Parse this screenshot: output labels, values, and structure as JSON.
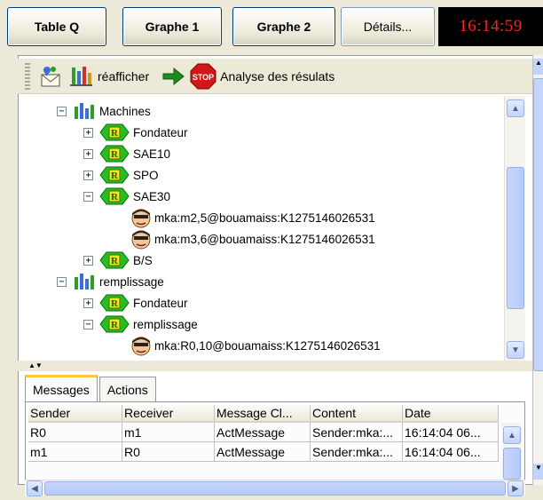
{
  "toolbar": {
    "buttons": [
      "Table Q",
      "Graphe 1",
      "Graphe 2",
      "Détails..."
    ],
    "clock": "16:14:59"
  },
  "actions": {
    "refresh_label": "réafficher",
    "analysis_label": "Analyse des résulats",
    "stop_text": "STOP"
  },
  "tree": {
    "nodes": [
      {
        "text": "Machines"
      },
      {
        "text": "Fondateur"
      },
      {
        "text": "SAE10"
      },
      {
        "text": "SPO"
      },
      {
        "text": "SAE30"
      },
      {
        "text": "mka:m2,5@bouamaiss:K1275146026531"
      },
      {
        "text": "mka:m3,6@bouamaiss:K1275146026531"
      },
      {
        "text": "B/S"
      },
      {
        "text": "remplissage"
      },
      {
        "text": "Fondateur"
      },
      {
        "text": "remplissage"
      },
      {
        "text": "mka:R0,10@bouamaiss:K1275146026531"
      }
    ],
    "badge_letter": "R"
  },
  "tabs": [
    "Messages",
    "Actions"
  ],
  "table": {
    "headers": [
      "Sender",
      "Receiver",
      "Message Cl...",
      "Content",
      "Date"
    ],
    "rows": [
      [
        "R0",
        "m1",
        "ActMessage",
        "Sender:mka:...",
        "16:14:04 06..."
      ],
      [
        "m1",
        "R0",
        "ActMessage",
        "Sender:mka:...",
        "16:14:04 06..."
      ]
    ]
  },
  "colors": {
    "clock_text": "#ff2020",
    "badge_green": "#22c022",
    "tab_highlight": "#ffc73c"
  }
}
